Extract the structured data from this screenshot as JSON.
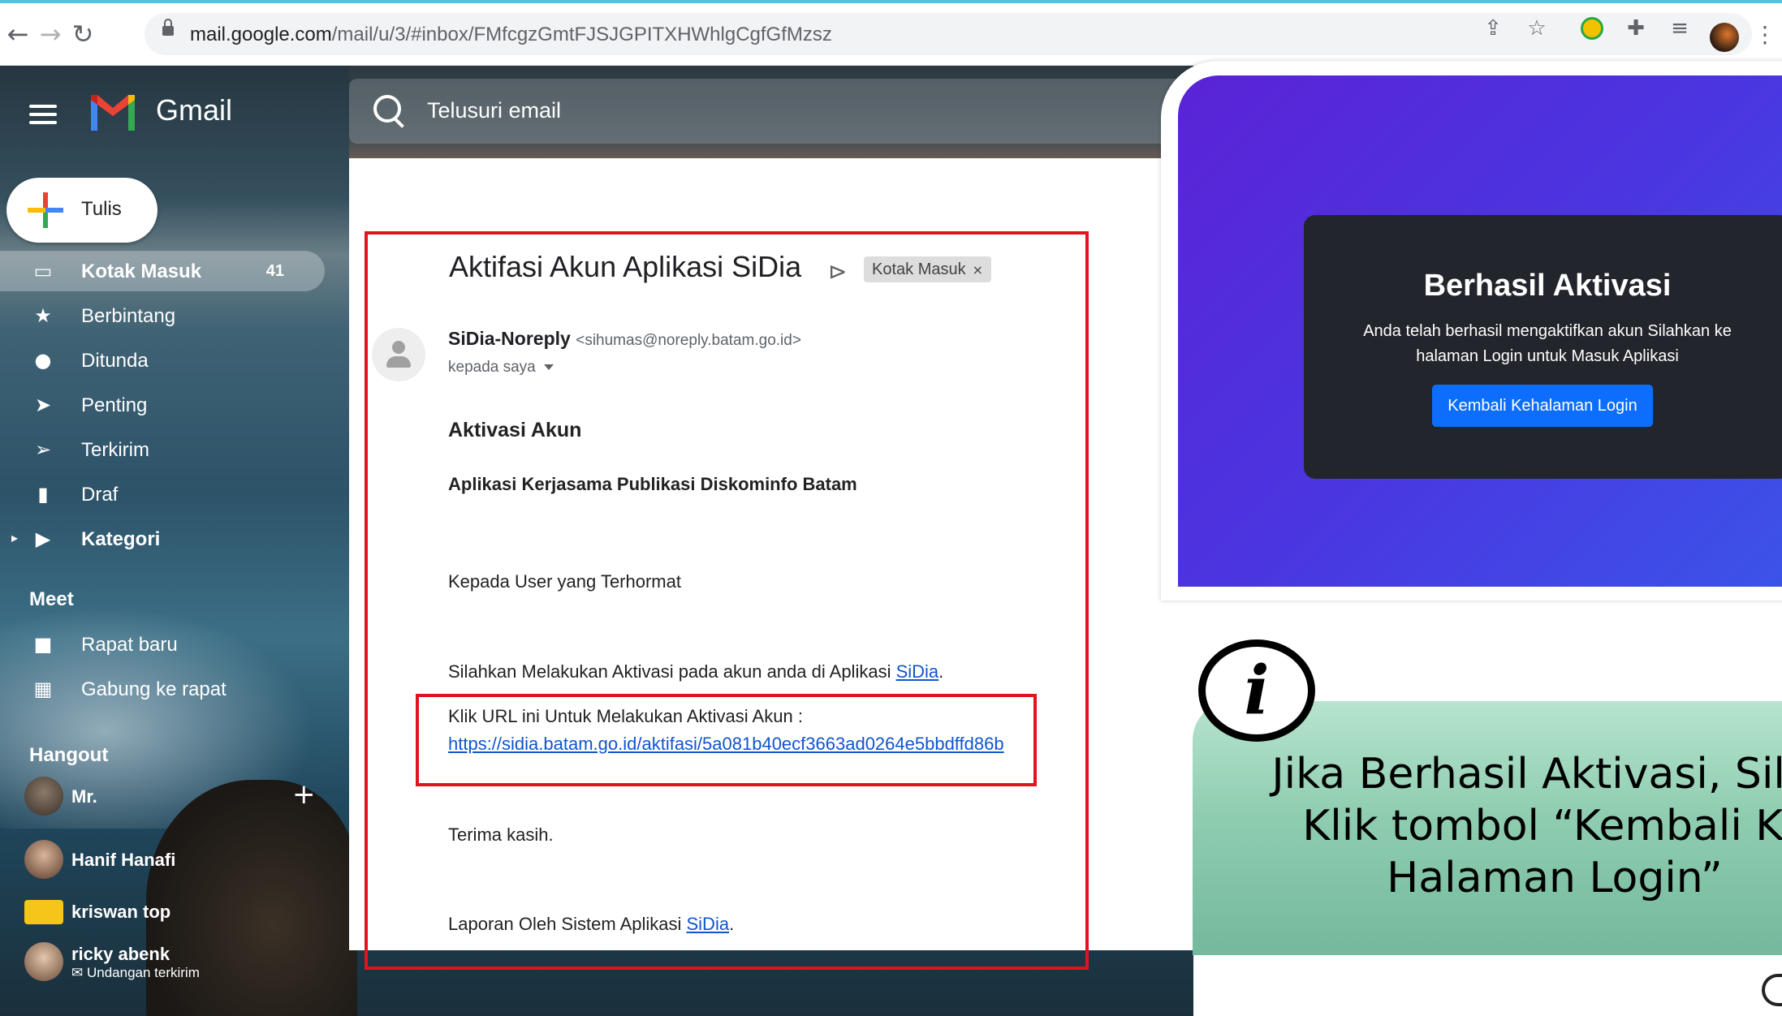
{
  "browser": {
    "url_host": "mail.google.com",
    "url_path": "/mail/u/3/#inbox/FMfcgzGmtFJSJGPITXHWhlgCgfGfMzsz"
  },
  "gmail": {
    "logo": "Gmail",
    "search_placeholder": "Telusuri email",
    "compose_label": "Tulis",
    "nav": [
      {
        "label": "Kotak Masuk",
        "count": "41",
        "icon": "inbox-icon"
      },
      {
        "label": "Berbintang",
        "icon": "star-icon"
      },
      {
        "label": "Ditunda",
        "icon": "clock-icon"
      },
      {
        "label": "Penting",
        "icon": "important-icon"
      },
      {
        "label": "Terkirim",
        "icon": "send-icon"
      },
      {
        "label": "Draf",
        "icon": "draft-icon"
      },
      {
        "label": "Kategori",
        "icon": "label-icon"
      }
    ],
    "meet": {
      "heading": "Meet",
      "items": [
        {
          "label": "Rapat baru",
          "icon": "video-icon"
        },
        {
          "label": "Gabung ke rapat",
          "icon": "keyboard-icon"
        }
      ]
    },
    "hangout": {
      "heading": "Hangout",
      "contacts": [
        {
          "name": "Mr.",
          "sub": ""
        },
        {
          "name": "Hanif Hanafi",
          "sub": ""
        },
        {
          "name": "kriswan top",
          "sub": ""
        },
        {
          "name": "ricky abenk",
          "sub": "Undangan terkirim"
        }
      ]
    }
  },
  "email": {
    "subject": "Aktifasi Akun Aplikasi SiDia",
    "label_chip": "Kotak Masuk",
    "sender_name": "SiDia-Noreply",
    "sender_email": "<sihumas@noreply.batam.go.id>",
    "to": "kepada saya",
    "heading": "Aktivasi Akun",
    "subheading": "Aplikasi Kerjasama Publikasi Diskominfo Batam",
    "greeting": "Kepada User yang Terhormat",
    "line1_prefix": "Silahkan Melakukan Aktivasi pada akun anda di Aplikasi ",
    "line1_link": "SiDia",
    "line1_suffix": ".",
    "url_label": "Klik URL ini Untuk Melakukan Aktivasi Akun :",
    "activation_url": "https://sidia.batam.go.id/aktifasi/5a081b40ecf3663ad0264e5bbdffd86b",
    "thanks": "Terima kasih.",
    "footer_prefix": "Laporan Oleh Sistem Aplikasi ",
    "footer_link": "SiDia",
    "footer_suffix": "."
  },
  "activation_screen": {
    "title": "Berhasil Aktivasi",
    "message": "Anda telah berhasil mengaktifkan akun Silahkan ke halaman Login untuk Masuk Aplikasi",
    "button": "Kembali Kehalaman Login"
  },
  "info": {
    "icon_glyph": "i",
    "lines": [
      "Jika Berhasil Aktivasi, Silah",
      "Klik tombol “Kembali Ke",
      "Halaman Login”"
    ]
  },
  "colors": {
    "highlight_red": "#e0141e",
    "link_blue": "#1155cc",
    "button_blue": "#0d6efd",
    "info_green": "#8fcdb0"
  }
}
